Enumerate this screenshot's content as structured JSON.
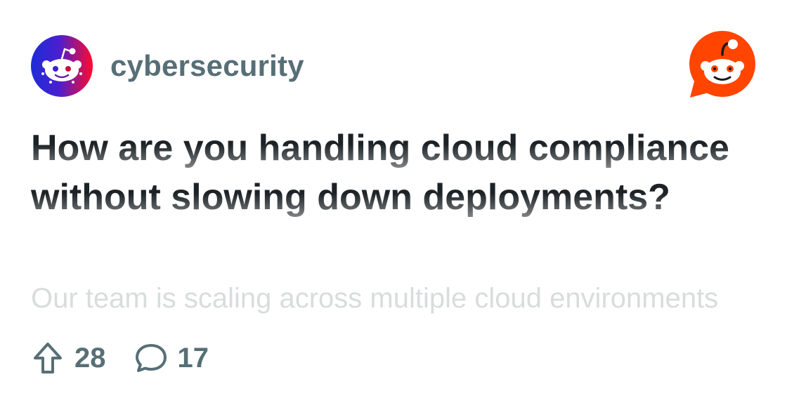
{
  "subreddit": {
    "name": "cybersecurity",
    "avatar_icon": "snoo-avatar-icon",
    "avatar_gradient": [
      "#1d2dd6",
      "#ff0a2e"
    ]
  },
  "brand": {
    "icon": "reddit-snoo-logo-icon",
    "color": "#ff4500"
  },
  "post": {
    "title": "How are you handling cloud compliance without slowing down deployments?",
    "body_preview": "Our team is scaling across multiple cloud environments"
  },
  "stats": {
    "upvotes": "28",
    "upvote_icon": "upvote-arrow-icon",
    "comments": "17",
    "comment_icon": "comment-bubble-icon"
  },
  "colors": {
    "title": "#1c2226",
    "meta": "#576f76",
    "body_faded": "#d9dcdd"
  }
}
